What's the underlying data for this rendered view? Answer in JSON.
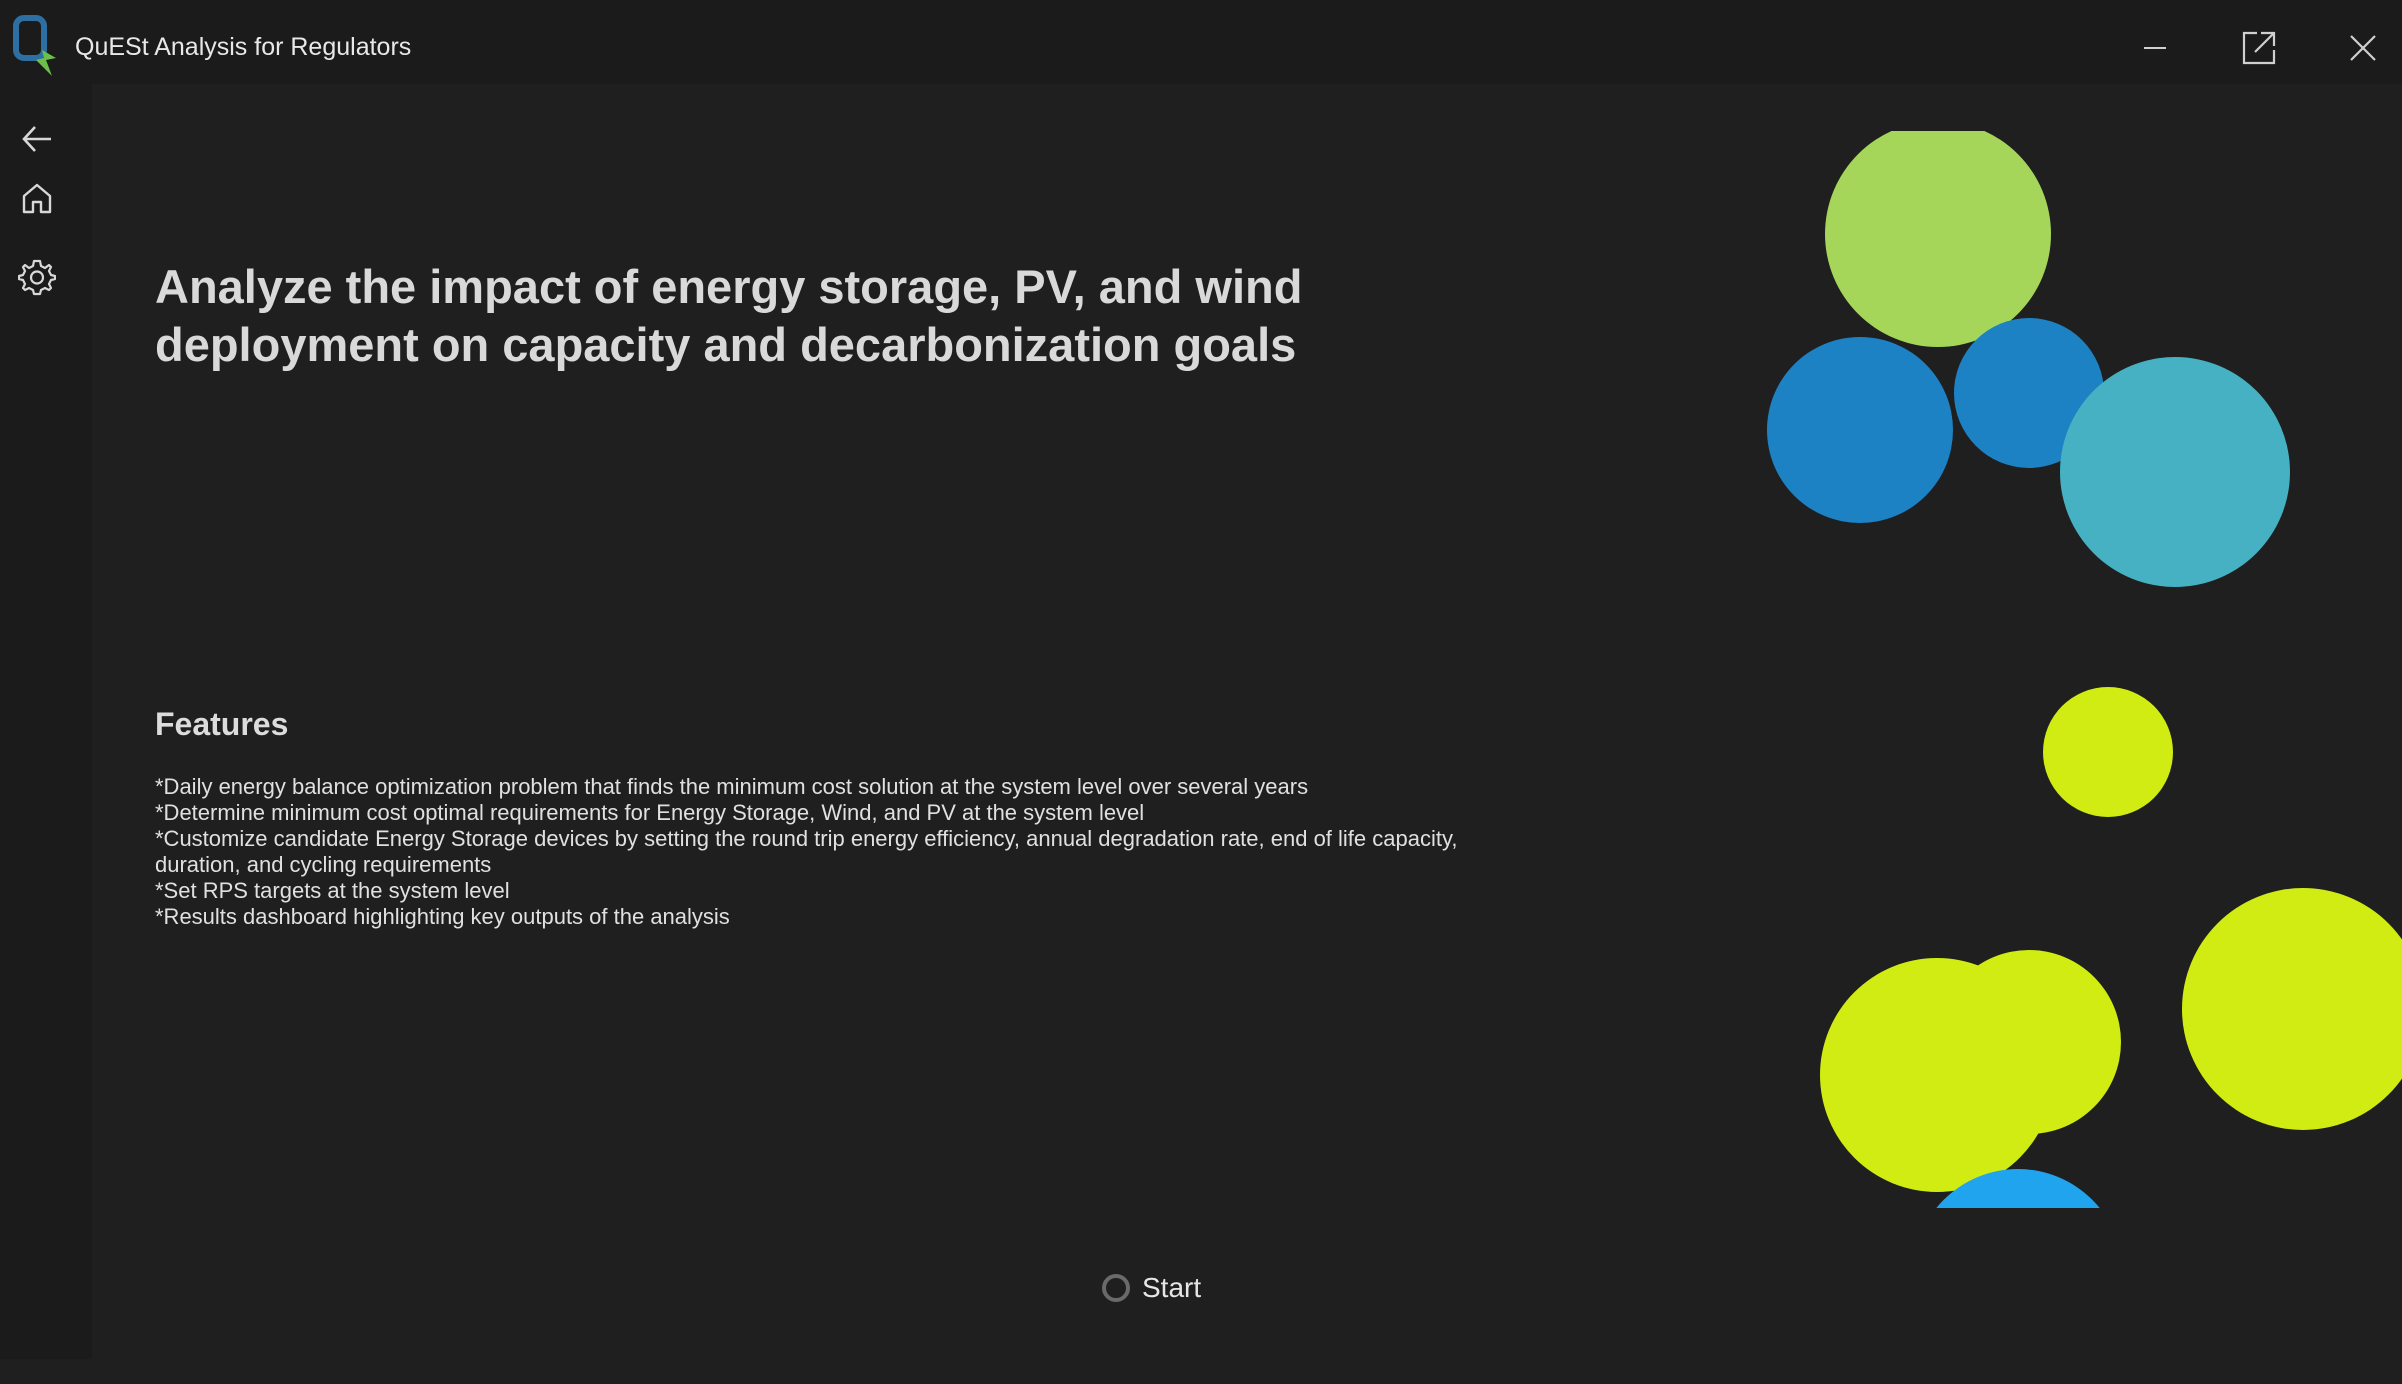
{
  "window": {
    "title": "QuESt Analysis for Regulators",
    "icons": {
      "logo": "quest-logo",
      "minimize": "minimize-icon",
      "maximize": "open-external-icon",
      "close": "close-icon"
    }
  },
  "sidebar": {
    "items": [
      {
        "name": "back",
        "icon": "arrow-left-icon"
      },
      {
        "name": "home",
        "icon": "home-icon"
      },
      {
        "name": "settings",
        "icon": "gear-icon"
      }
    ]
  },
  "main": {
    "headline": "Analyze the impact of energy storage, PV, and wind deployment on capacity and decarbonization goals",
    "features_title": "Features",
    "features": [
      "*Daily energy balance optimization problem that finds the minimum cost solution at the system level over several years",
      "*Determine minimum cost optimal requirements for Energy Storage, Wind, and PV at the system level",
      "*Customize candidate Energy Storage devices by setting the round trip energy efficiency, annual degradation rate, end of life capacity, duration, and cycling requirements",
      "*Set RPS targets at the system level",
      "*Results dashboard highlighting key outputs of the analysis"
    ],
    "start_label": "Start"
  },
  "colors": {
    "background": "#1f1f1f",
    "light_green": "#a5d65a",
    "blue": "#1c82c4",
    "teal": "#45b1c3",
    "lime": "#d0ec12",
    "sky_blue": "#21a4ee"
  }
}
